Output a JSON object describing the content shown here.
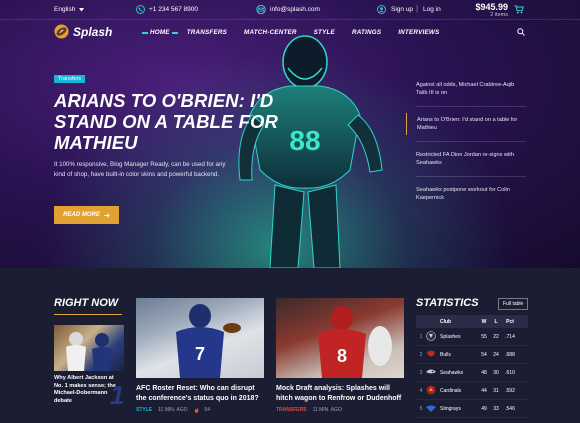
{
  "topbar": {
    "language": "English",
    "phone": "+1 234 567 8900",
    "email": "info@splash.com",
    "signup": "Sign up",
    "login": "Log in",
    "cart_price": "$945.99",
    "cart_items": "2 items"
  },
  "brand": {
    "name": "Splash"
  },
  "nav": {
    "items": [
      {
        "label": "HOME"
      },
      {
        "label": "TRANSFERS"
      },
      {
        "label": "MATCH-CENTER"
      },
      {
        "label": "STYLE"
      },
      {
        "label": "RATINGS"
      },
      {
        "label": "INTERVIEWS"
      }
    ]
  },
  "hero": {
    "badge": "Transfers",
    "title": "ARIANS TO O'BRIEN: I'D STAND ON A TABLE FOR MATHIEU",
    "description": "It 100% responsive, Blog Manager Ready, can be used for any kind of shop, have built-in color skins and powerful backend.",
    "cta": "READ MORE",
    "jersey_number": "88"
  },
  "side_news": [
    {
      "text": "Against all odds, Michael Crabtree-Aqib Talib III is on"
    },
    {
      "text": "Arians to O'Brien: I'd stand on a table for Mathieu"
    },
    {
      "text": "Restricted FA Dion Jordan re-signs with Seahawks"
    },
    {
      "text": "Seahawks postpone workout for Colin Kaepernick"
    }
  ],
  "right_now": {
    "title": "RIGHT NOW",
    "story": "Why Albert Jackson at No. 1 makes sense; the Michael-Dobermann debate",
    "number": "1"
  },
  "cards": [
    {
      "title": "AFC Roster Reset: Who can disrupt the conference's status quo in 2018?",
      "category": "STYLE",
      "time": "11 MIN. AGO",
      "count": "54"
    },
    {
      "title": "Mock Draft analysis: Splashes will hitch wagon to Renfrow or Dudenhoff",
      "category": "TRANSFERS",
      "time": "11 MIN. AGO"
    }
  ],
  "statistics": {
    "title": "STATISTICS",
    "full_table": "Full table",
    "headers": {
      "club": "Club",
      "w": "W",
      "l": "L",
      "pct": "Pct"
    },
    "rows": [
      {
        "rank": "1",
        "club": "Splashes",
        "w": "55",
        "l": "22",
        "pct": ".714"
      },
      {
        "rank": "2",
        "club": "Bulls",
        "w": "54",
        "l": "24",
        "pct": ".688"
      },
      {
        "rank": "3",
        "club": "Seahawks",
        "w": "48",
        "l": "30",
        "pct": ".610"
      },
      {
        "rank": "4",
        "club": "Cardinals",
        "w": "44",
        "l": "31",
        "pct": ".592"
      },
      {
        "rank": "5",
        "club": "Stingrays",
        "w": "49",
        "l": "33",
        "pct": ".546"
      }
    ]
  },
  "colors": {
    "accent": "#e2a232",
    "teal": "#2fd5c7",
    "badge": "#19b5d8",
    "background": "#1b1d33"
  }
}
